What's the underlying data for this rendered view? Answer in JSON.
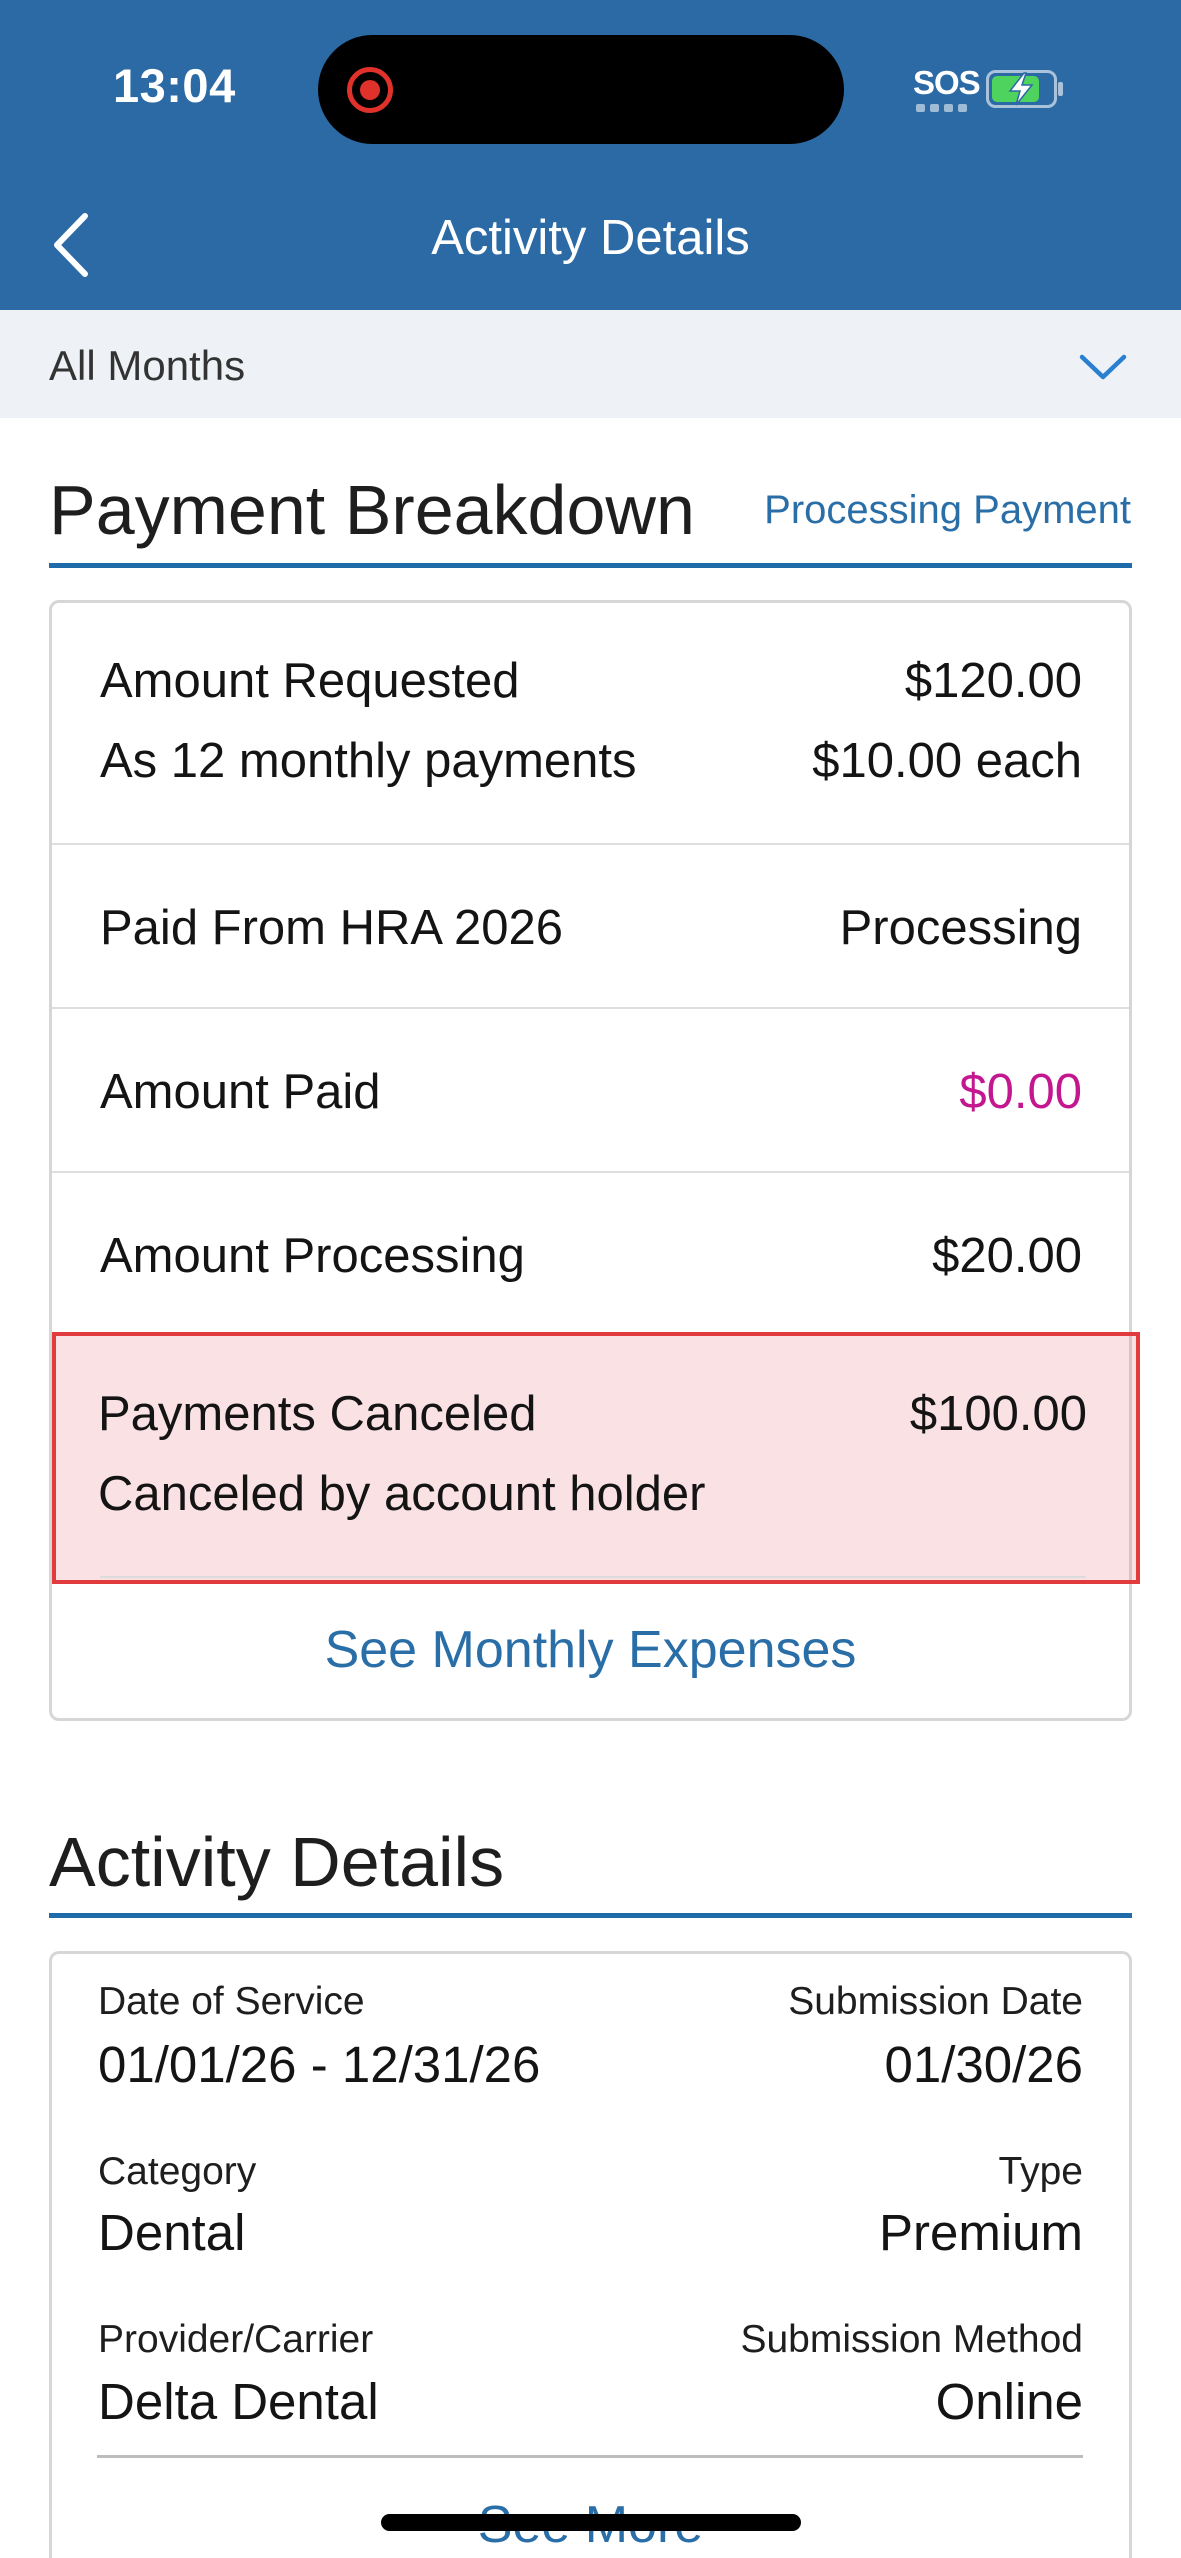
{
  "status_bar": {
    "time": "13:04",
    "carrier_text": "SOS"
  },
  "nav": {
    "title": "Activity Details"
  },
  "filter": {
    "selected": "All Months"
  },
  "payment_breakdown": {
    "title": "Payment Breakdown",
    "status": "Processing Payment",
    "rows": [
      {
        "label": "Amount Requested",
        "value": "$120.00",
        "sub_label": "As 12 monthly payments",
        "sub_value": "$10.00 each"
      },
      {
        "label": "Paid From HRA 2026",
        "value": "Processing"
      },
      {
        "label": "Amount Paid",
        "value": "$0.00"
      },
      {
        "label": "Amount Processing",
        "value": "$20.00"
      },
      {
        "label": "Payments Canceled",
        "value": "$100.00",
        "sub_label": "Canceled by account holder"
      }
    ],
    "link": "See Monthly Expenses",
    "colors": {
      "amount_paid": "#c3168f",
      "accent": "#2a6ea8",
      "highlight_border": "#e23b3e"
    }
  },
  "activity_details": {
    "title": "Activity Details",
    "fields": {
      "date_of_service": {
        "label": "Date of Service",
        "value": "01/01/26 - 12/31/26"
      },
      "submission_date": {
        "label": "Submission Date",
        "value": "01/30/26"
      },
      "category": {
        "label": "Category",
        "value": "Dental"
      },
      "type": {
        "label": "Type",
        "value": "Premium"
      },
      "provider": {
        "label": "Provider/Carrier",
        "value": "Delta Dental"
      },
      "submission_method": {
        "label": "Submission Method",
        "value": "Online"
      }
    },
    "link": "See More"
  },
  "icons": {
    "back": "chevron-left-icon",
    "dropdown": "chevron-down-icon",
    "battery": "battery-charging-icon",
    "recording": "screen-recording-icon"
  }
}
